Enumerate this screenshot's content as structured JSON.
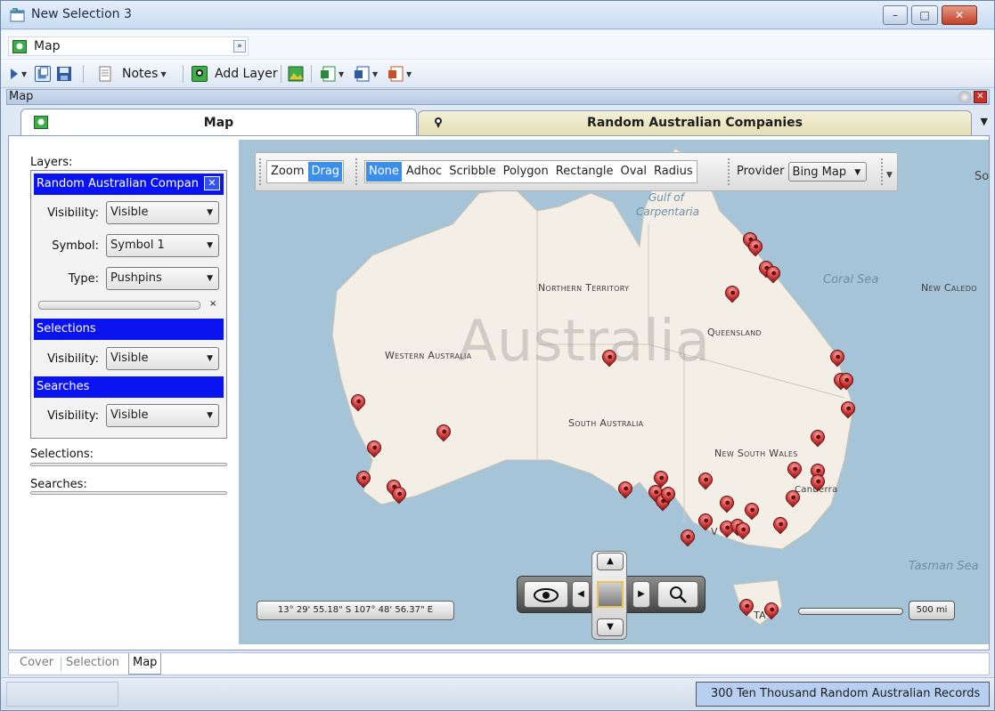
{
  "window": {
    "title": "New Selection 3",
    "minimize": "–",
    "maximize": "□",
    "close": "✕"
  },
  "menu": {
    "map_label": "Map",
    "more": "»"
  },
  "toolbar": {
    "notes_label": "Notes",
    "add_layer_label": "Add Layer"
  },
  "pane": {
    "title": "Map"
  },
  "doc_tabs": [
    {
      "label": "Map"
    },
    {
      "label": "Random Australian Companies"
    }
  ],
  "left_panel": {
    "layers_label": "Layers:",
    "layer_title": "Random Australian Compan",
    "close": "✕",
    "visibility_label": "Visibility:",
    "visibility_value": "Visible",
    "symbol_label": "Symbol:",
    "symbol_value": "Symbol 1",
    "type_label": "Type:",
    "type_value": "Pushpins",
    "slider_x": "×",
    "selections_title": "Selections",
    "selections_visibility_label": "Visibility:",
    "selections_visibility_value": "Visible",
    "searches_title": "Searches",
    "searches_visibility_label": "Visibility:",
    "searches_visibility_value": "Visible",
    "selections_label": "Selections:",
    "searches_label": "Searches:"
  },
  "map_toolbar": {
    "zoom": "Zoom",
    "drag": "Drag",
    "modes": [
      "None",
      "Adhoc",
      "Scribble",
      "Polygon",
      "Rectangle",
      "Oval",
      "Radius"
    ],
    "provider_label": "Provider",
    "provider_value": "Bing Map",
    "edge_text": "So"
  },
  "map_labels": {
    "country": "Australia",
    "northern_territory": "Northern Territory",
    "queensland": "Queensland",
    "western_australia": "Western Australia",
    "south_australia": "South Australia",
    "new_south_wales": "New South Wales",
    "canberra": "Canberra",
    "gulf": "Gulf of",
    "gulf2": "Carpentaria",
    "coral_sea": "Coral Sea",
    "tasman_sea": "Tasman Sea",
    "new_caledonia": "New Caledo",
    "tas": "TA",
    "vic": "V"
  },
  "coords": "13° 29' 55.18\" S 107° 48' 56.37\" E",
  "scale": "500 mi",
  "bottom_tabs": [
    "Cover",
    "Selection",
    "Map"
  ],
  "status": "300 Ten Thousand Random Australian Records",
  "colors": {
    "layer_header": "#0a14f0",
    "selected_mode": "#3d8ee8",
    "pin": "#d03b3b",
    "water": "#a6c4d8",
    "land": "#f3efe6"
  }
}
